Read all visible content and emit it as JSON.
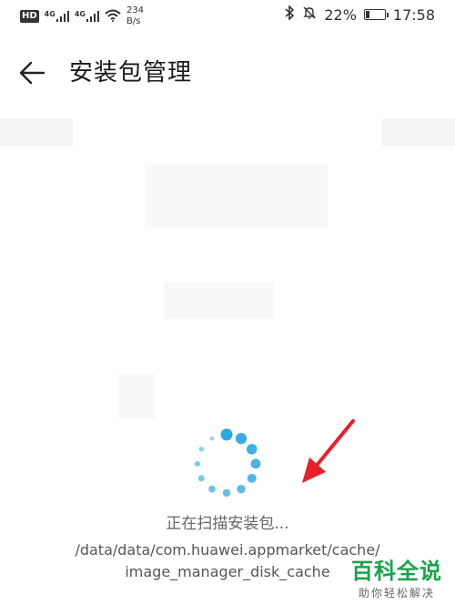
{
  "status_bar": {
    "badge": "HD",
    "network1": "4G",
    "network2": "4G",
    "speed_value": "234",
    "speed_unit": "B/s",
    "battery": "22%",
    "battery_level": 0.22,
    "time": "17:58"
  },
  "header": {
    "title": "安装包管理"
  },
  "scan": {
    "status": "正在扫描安装包...",
    "path_line1": "/data/data/com.huawei.appmarket/cache/",
    "path_line2": "image_manager_disk_cache"
  },
  "watermark": {
    "main": "百科全说",
    "sub": "助你轻松解决"
  },
  "colors": {
    "spinner": "#2aa8e0",
    "arrow": "#e8202a",
    "watermark": "#1aa34a"
  }
}
